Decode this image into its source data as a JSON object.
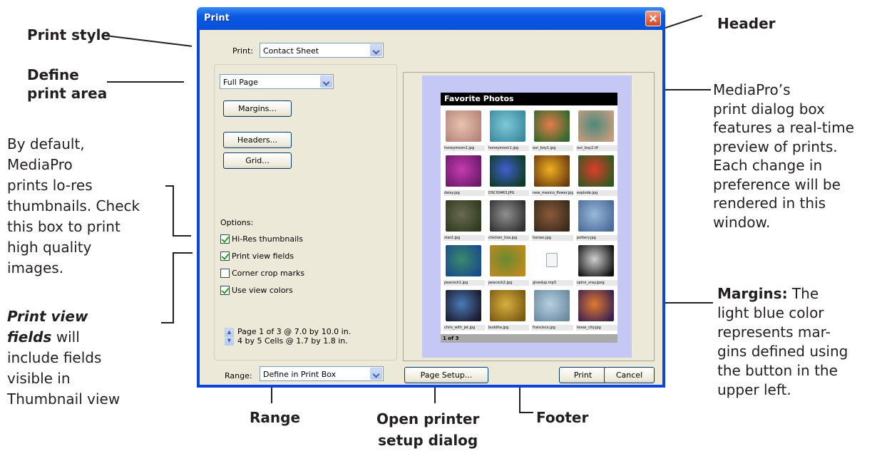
{
  "annotations": {
    "print_style": "Print style",
    "define_print_area_1": "Define",
    "define_print_area_2": "print area",
    "by_default": [
      "By default,",
      "MediaPro",
      "prints lo-res",
      "thumbnails. Check",
      "this box to print",
      "high quality",
      "images."
    ],
    "print_view_fields_1": "Print view",
    "print_view_fields_2": "fields",
    "print_view_fields_3": " will",
    "print_view_fields_rest": [
      "include fields",
      "visible in",
      "Thumbnail view"
    ],
    "header": "Header",
    "preview_desc": [
      "MediaPro’s",
      "print dialog box",
      "features a real-time",
      "preview of prints.",
      "Each change in",
      "preference will be",
      "rendered in this",
      "window."
    ],
    "margins_bold": "Margins:",
    "margins_rest_1": " The",
    "margins_rest": [
      "light blue color",
      "represents mar-",
      "gins defined using",
      "the button in the",
      "upper left."
    ],
    "range": "Range",
    "open_printer_1": "Open printer",
    "open_printer_2": "setup dialog",
    "footer": "Footer"
  },
  "dialog": {
    "title": "Print",
    "print_label": "Print:",
    "print_value": "Contact Sheet",
    "area_value": "Full Page",
    "margins_button": "Margins...",
    "headers_button": "Headers...",
    "grid_button": "Grid...",
    "options_label": "Options:",
    "options": [
      {
        "label": "Hi-Res thumbnails",
        "checked": true
      },
      {
        "label": "Print view fields",
        "checked": true
      },
      {
        "label": "Corner crop marks",
        "checked": false
      },
      {
        "label": "Use view colors",
        "checked": true
      }
    ],
    "page_info_1": "Page 1 of 3 @ 7.0 by 10.0 in.",
    "page_info_2": "4 by 5 Cells @ 1.7 by 1.8 in.",
    "range_label": "Range:",
    "range_value": "Define in Print Box",
    "page_setup_button": "Page Setup...",
    "print_button": "Print",
    "cancel_button": "Cancel"
  },
  "preview": {
    "header_title": "Favorite Photos",
    "footer_text": "1 of 3",
    "thumbnails": [
      {
        "caption": "honeymoon2.jpg",
        "colors": [
          "#e9c3b0",
          "#b5857a"
        ]
      },
      {
        "caption": "honeymoon1.jpg",
        "colors": [
          "#7fc8d6",
          "#3c8aa0"
        ]
      },
      {
        "caption": "our_boy1.jpg",
        "colors": [
          "#e67b4a",
          "#2e6a2c"
        ]
      },
      {
        "caption": "our_boy2.tif",
        "colors": [
          "#4d8a7a",
          "#c79c80"
        ]
      },
      {
        "caption": "daisy.jpg",
        "colors": [
          "#c43bb0",
          "#6a1a6a"
        ]
      },
      {
        "caption": "DSC00463.JPG",
        "colors": [
          "#3f5fd0",
          "#0e3a1e"
        ]
      },
      {
        "caption": "new_mexico_flower.jpg",
        "colors": [
          "#f0b020",
          "#6a3a10"
        ]
      },
      {
        "caption": "explode.jpg",
        "colors": [
          "#e03b2a",
          "#2a5a20"
        ]
      },
      {
        "caption": "star2.jpg",
        "colors": [
          "#6a6a50",
          "#2e3a20"
        ]
      },
      {
        "caption": "chichen_itza.jpg",
        "colors": [
          "#909090",
          "#303030"
        ]
      },
      {
        "caption": "horses.jpg",
        "colors": [
          "#8a5a3a",
          "#3a2a1a"
        ]
      },
      {
        "caption": "pottery.jpg",
        "colors": [
          "#9ab8d8",
          "#4a6a9a"
        ]
      },
      {
        "caption": "peacock1.jpg",
        "colors": [
          "#3a8a6a",
          "#1a4a8a"
        ]
      },
      {
        "caption": "peacock2.jpg",
        "colors": [
          "#6a8a30",
          "#c08a20"
        ]
      },
      {
        "caption": "givedup.mp3",
        "colors": [
          "#ffffff",
          "#ffffff"
        ],
        "file": true
      },
      {
        "caption": "spine_xray.jpeg",
        "colors": [
          "#d0d0d0",
          "#101010"
        ]
      },
      {
        "caption": "chris_with_jet.jpg",
        "colors": [
          "#4a7ab8",
          "#1a1a2a"
        ]
      },
      {
        "caption": "buddha.jpg",
        "colors": [
          "#d8b040",
          "#7a5a10"
        ]
      },
      {
        "caption": "francisco.jpg",
        "colors": [
          "#b8d0e0",
          "#6a8aa0"
        ]
      },
      {
        "caption": "texas_city.jpg",
        "colors": [
          "#e07a30",
          "#3a2050"
        ]
      }
    ]
  }
}
